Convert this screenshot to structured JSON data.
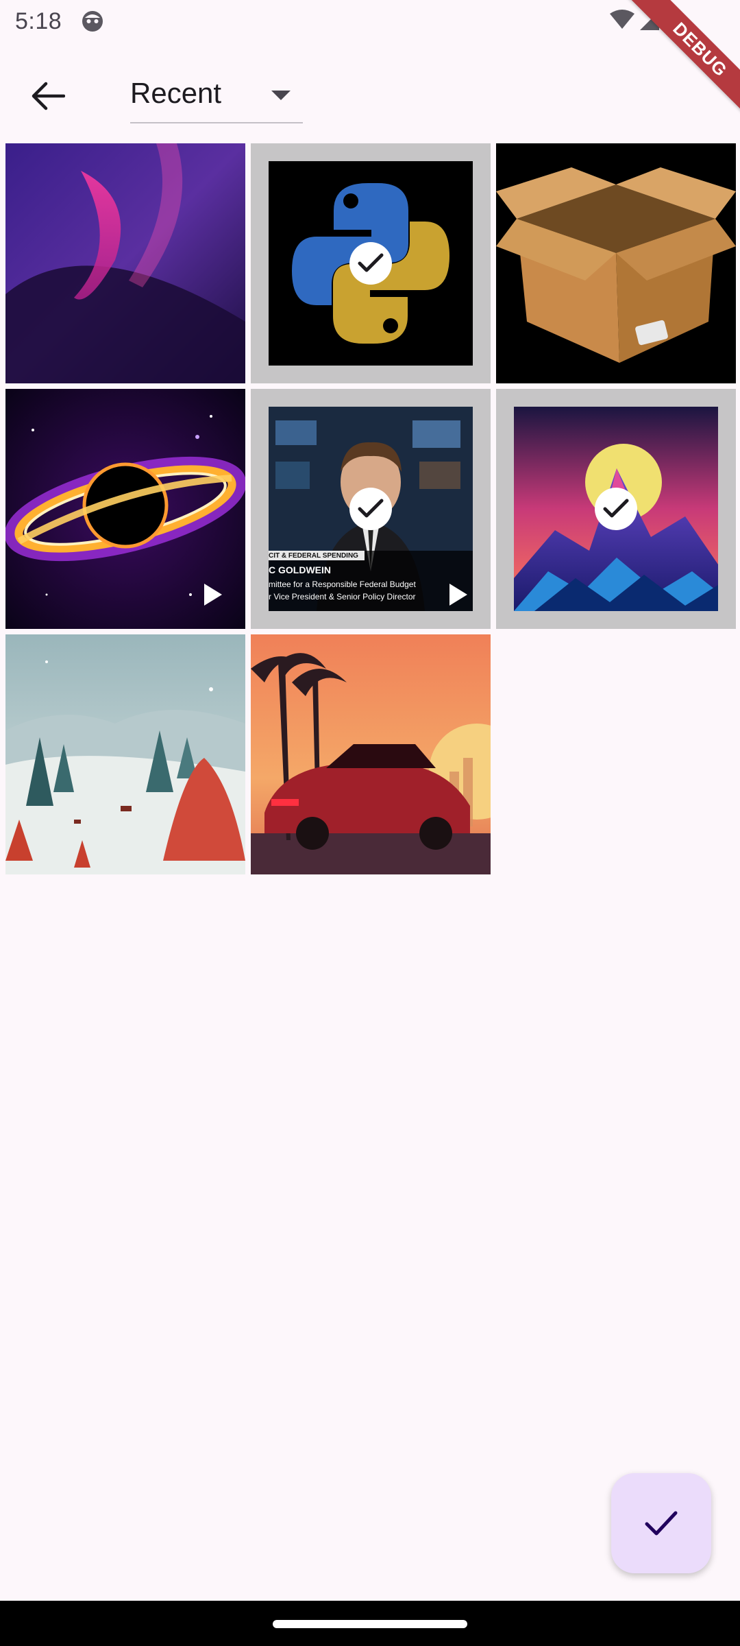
{
  "status_bar": {
    "time": "5:18",
    "debug_label": "DEBUG"
  },
  "app_bar": {
    "album_name": "Recent"
  },
  "grid": {
    "items": [
      {
        "name": "abstract-wave",
        "selected": false,
        "video": false
      },
      {
        "name": "python-logo",
        "selected": true,
        "video": false
      },
      {
        "name": "cardboard-box",
        "selected": false,
        "video": false
      },
      {
        "name": "black-hole",
        "selected": false,
        "video": true
      },
      {
        "name": "news-interview",
        "selected": true,
        "video": true
      },
      {
        "name": "synthwave-mountain",
        "selected": true,
        "video": false
      },
      {
        "name": "winter-forest",
        "selected": false,
        "video": false
      },
      {
        "name": "sunset-car",
        "selected": false,
        "video": false
      }
    ],
    "news_caption": {
      "line1": "CIT & FEDERAL SPENDING",
      "line2": "C GOLDWEIN",
      "line3": "mittee for a Responsible Federal Budget",
      "line4": "r Vice President & Senior Policy Director"
    }
  },
  "colors": {
    "accent": "#6750a4",
    "fab": "#ebdcfb",
    "background": "#fdf7fb"
  }
}
